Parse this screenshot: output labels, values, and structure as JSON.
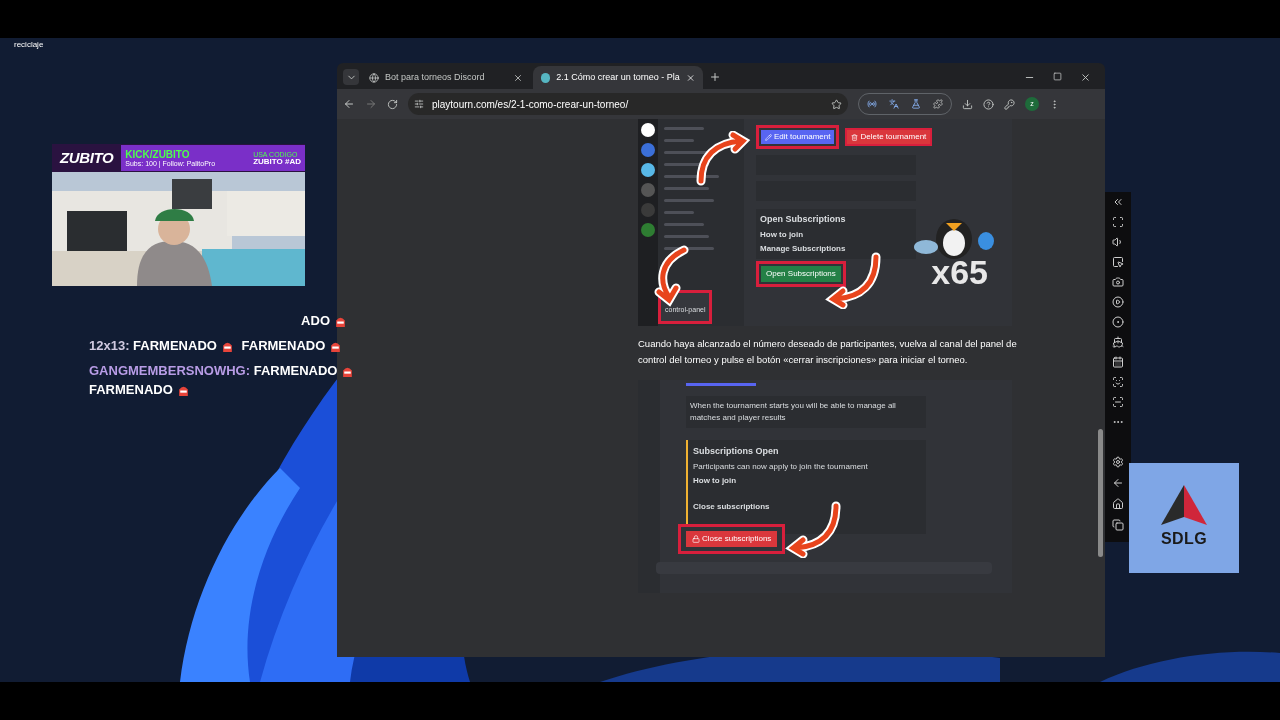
{
  "desktop": {
    "icon_label": "reciclaje"
  },
  "browser": {
    "tabs": [
      {
        "title": "Bot para torneos Discord",
        "selected": false
      },
      {
        "title": "2.1 Cómo crear un torneo - Pla",
        "selected": true
      }
    ],
    "url": "playtourn.com/es/2-1-como-crear-un-torneo/",
    "profile_initial": "z"
  },
  "article": {
    "screenshot_1": {
      "edit_button": "Edit tournament",
      "delete_button": "Delete tournament",
      "section_title": "Open Subscriptions",
      "subtitle_1": "How to join",
      "subtitle_2": "Manage Subscriptions",
      "open_button": "Open Subscriptions",
      "channel": "control-panel",
      "sticker_text": "x65"
    },
    "paragraph": "Cuando haya alcanzado el número deseado de participantes, vuelva al canal del panel de control del torneo y pulse el botón «cerrar inscripciones» para iniciar el torneo.",
    "screenshot_2": {
      "note": "When the tournament starts you will be able to manage all matches and player results",
      "title": "Subscriptions Open",
      "description": "Participants can now apply to join the tournament",
      "subtitle_1": "How to join",
      "subtitle_2": "Close subscriptions",
      "close_button": "Close subscriptions"
    }
  },
  "stream_overlay": {
    "logo": "ZUBITO",
    "platform": "KICK/ZUBITO",
    "stats": "Subs: 100 | Follow: PalitoPro",
    "code_label": "USA CODIGO",
    "code": "ZUBITO #AD"
  },
  "chat": {
    "partial_line": "ADO",
    "messages": [
      {
        "user": "12x13:",
        "color": "#cfc9e0",
        "words": [
          "FARMENADO",
          "FARMENADO"
        ]
      },
      {
        "user": "GANGMEMBERSNOWHG:",
        "color": "#b89ce6",
        "words": [
          "FARMENADO",
          "FARMENADO"
        ]
      }
    ]
  },
  "side_logo": {
    "text": "SDLG"
  }
}
